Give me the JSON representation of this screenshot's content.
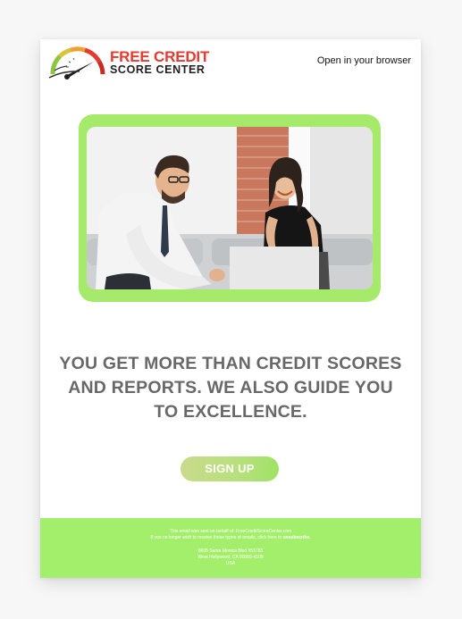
{
  "header": {
    "logo_line1": "FREE CREDIT",
    "logo_line2": "SCORE CENTER",
    "open_in_browser": "Open in your browser"
  },
  "hero": {
    "image_icon": "people-with-laptop-photo"
  },
  "headline": {
    "line1": "YOU GET MORE THAN CREDIT SCORES",
    "line2": "AND REPORTS. WE ALSO GUIDE YOU",
    "line3": "TO EXCELLENCE."
  },
  "cta": {
    "label": "SIGN UP"
  },
  "footer": {
    "sent_on_behalf": "This email was sent on behalf of: FreeCreditScoreCenter.com",
    "unsubscribe_prefix": "If you no longer wish to receive these types of emails, click here to",
    "unsubscribe_link": "unsubscribe.",
    "address_line1": "8605 Santa Monica Blvd #53783",
    "address_line2": "West Hollywood, CA 90069-4109",
    "address_line3": "USA"
  },
  "colors": {
    "brand_red": "#e53a2f",
    "brand_green": "#a3ef6b",
    "headline_gray": "#686868",
    "background": "#f7f7f7"
  }
}
